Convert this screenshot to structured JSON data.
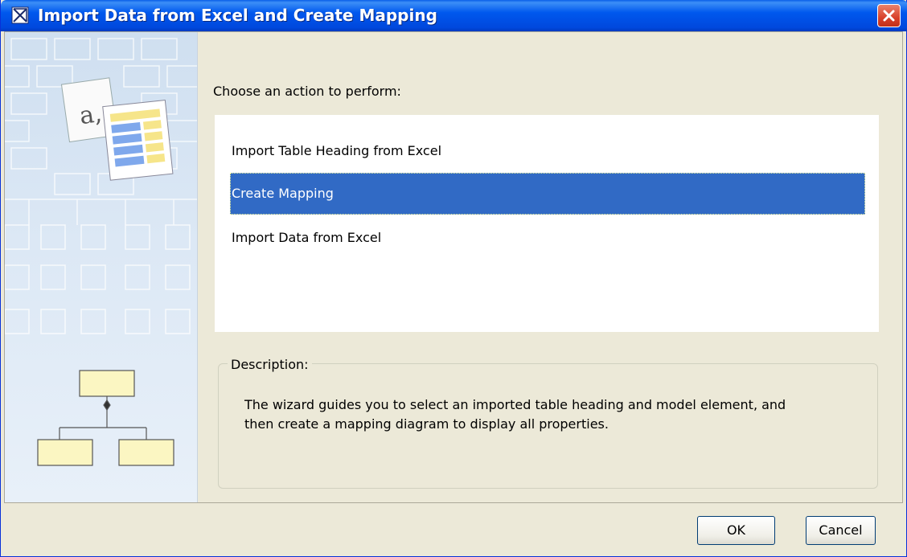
{
  "window": {
    "title": "Import Data from Excel and Create Mapping"
  },
  "main": {
    "prompt": "Choose an action to perform:",
    "actions": [
      {
        "label": "Import Table Heading from Excel",
        "selected": false
      },
      {
        "label": "Create Mapping",
        "selected": true
      },
      {
        "label": "Import Data from Excel",
        "selected": false
      }
    ]
  },
  "description": {
    "legend": "Description:",
    "line1": "The wizard guides you to select an imported table heading and model element, and",
    "line2": "then create a mapping diagram to display all properties."
  },
  "side_banner": {
    "icon_glyph": "a,"
  },
  "buttons": {
    "ok_label": "OK",
    "cancel_label": "Cancel"
  },
  "colors": {
    "titlebar": "#0058ee",
    "selection": "#316ac5",
    "dialog_bg": "#ece9d8"
  }
}
